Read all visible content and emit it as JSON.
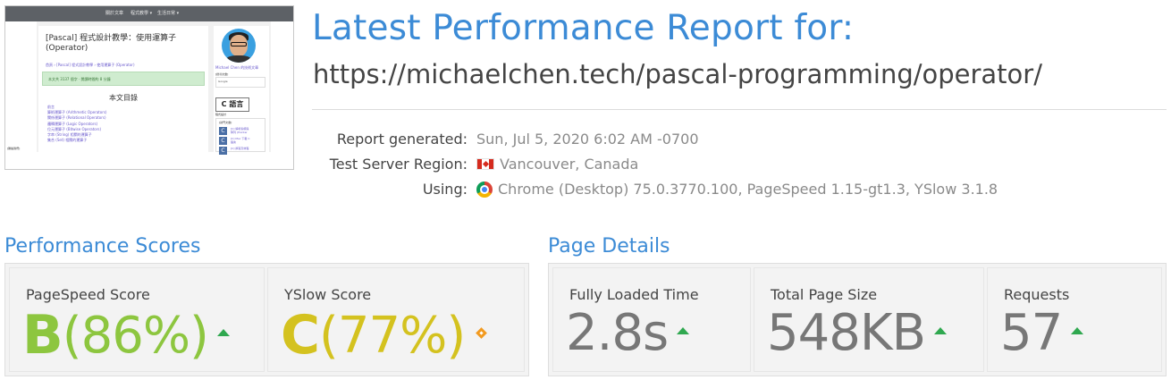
{
  "thumbnail": {
    "nav_home": "關於文章",
    "nav_item_1": "程式教學 ▾",
    "nav_item_2": "生活日常 ▾",
    "article_title": "[Pascal] 程式設計教學：使用運算子 (Operator)",
    "breadcrumb": "首頁 › [Pascal] 程式設計教學 › 使用運算子 (Operator)",
    "notice": "本文共 3137 個字 · 閱讀時間約 8 分鐘",
    "toc_title": "本文目錄",
    "toc_items": [
      "前言",
      "算術運算子 (Arithmetic Operators)",
      "關係運算子 (Relational Operators)",
      "邏輯運算子 (Logic Operators)",
      "位元運算子 (Bitwise Operators)",
      "字串 (String) 相關的運算子",
      "集合 (Set) 相關的運算子"
    ],
    "sidebar_name": "Michael Chen 的技術文章",
    "sidebar_search_label": "[搜尋文章]",
    "sidebar_search_btn": "Google",
    "sidebar_logo": "C 語言",
    "sidebar_logo_sub": "程式設計",
    "sidebar_list_header": "[熱門文章]",
    "sidebar_list_1": "[C] 解析指標與",
    "sidebar_list_2": "陣列 (Pointer",
    "sidebar_list_3": "[C] Mac 下載 C",
    "sidebar_list_4": "語言",
    "sidebar_list_5": "[C] 撰寫高效程",
    "footer": "[聯絡我們]"
  },
  "header": {
    "title": "Latest Performance Report for:",
    "url": "https://michaelchen.tech/pascal-programming/operator/"
  },
  "meta": {
    "report_generated_label": "Report generated:",
    "report_generated_value": "Sun, Jul 5, 2020 6:02 AM -0700",
    "region_label": "Test Server Region:",
    "region_value": "Vancouver, Canada",
    "using_label": "Using:",
    "using_value": "Chrome (Desktop) 75.0.3770.100, PageSpeed 1.15-gt1.3, YSlow 3.1.8",
    "icons": {
      "region": "canada-flag-icon",
      "using": "chrome-icon"
    }
  },
  "performance": {
    "title": "Performance Scores",
    "pagespeed": {
      "label": "PageSpeed Score",
      "grade": "B",
      "percent": "(86%)",
      "trend": "up-arrow-icon",
      "color": "#8dc63f"
    },
    "yslow": {
      "label": "YSlow Score",
      "grade": "C",
      "percent": "(77%)",
      "trend": "diamond-icon",
      "color": "#d4c21f"
    }
  },
  "details": {
    "title": "Page Details",
    "load_time": {
      "label": "Fully Loaded Time",
      "value": "2.8s"
    },
    "page_size": {
      "label": "Total Page Size",
      "value": "548KB"
    },
    "requests": {
      "label": "Requests",
      "value": "57"
    },
    "trend_color": "#2fa84f"
  }
}
